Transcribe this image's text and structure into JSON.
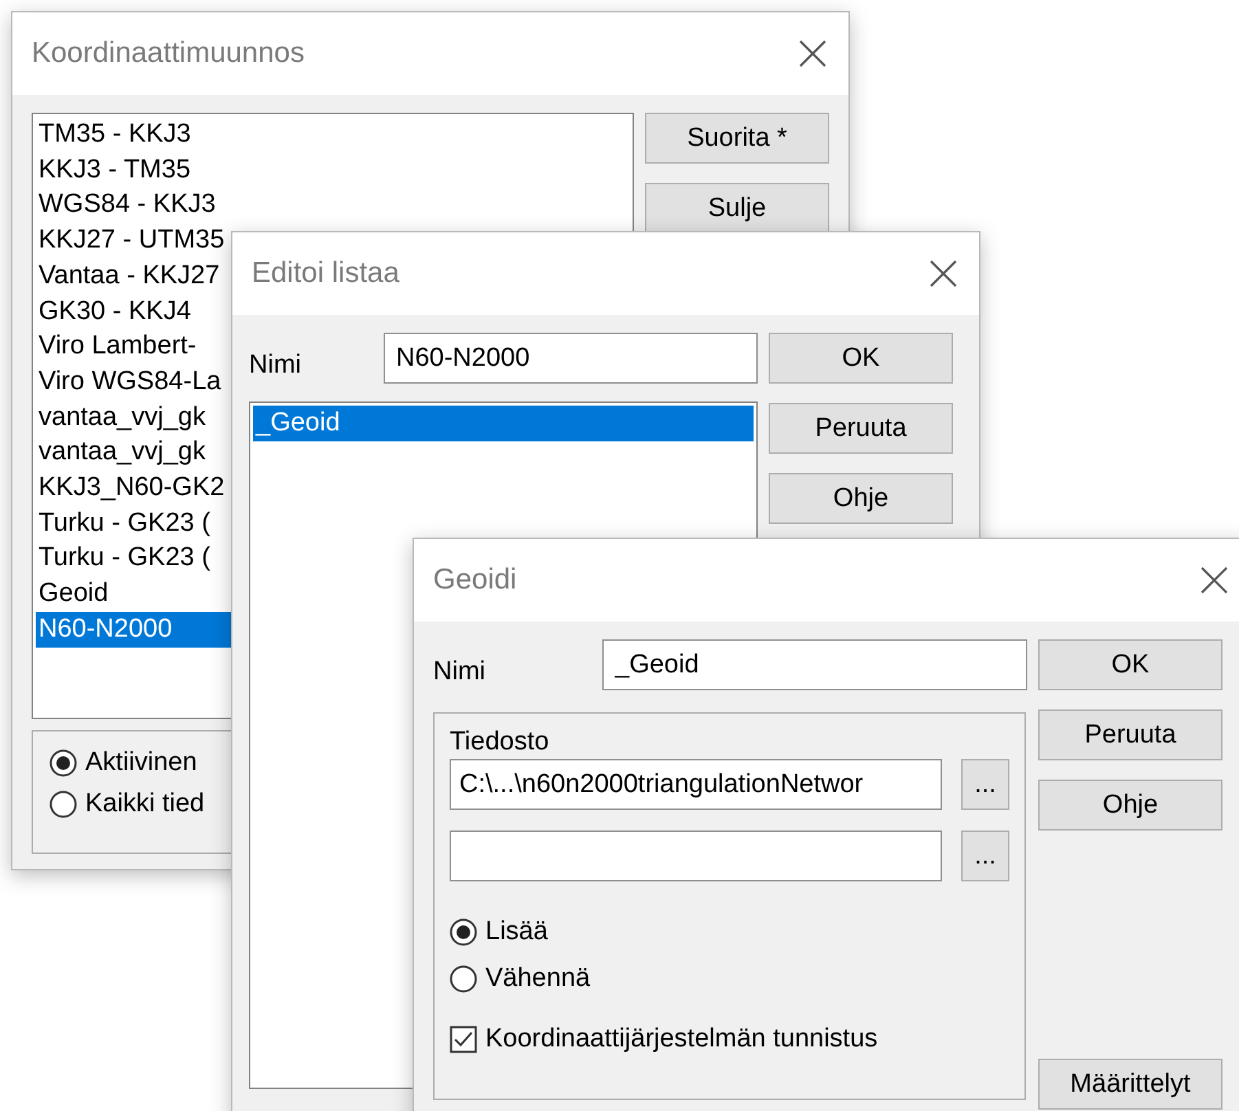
{
  "main_window": {
    "title": "Koordinaattimuunnos",
    "items": [
      {
        "label": "TM35 - KKJ3",
        "selected": false
      },
      {
        "label": "KKJ3 - TM35",
        "selected": false
      },
      {
        "label": "WGS84 - KKJ3",
        "selected": false
      },
      {
        "label": "KKJ27 - UTM35",
        "selected": false
      },
      {
        "label": "Vantaa - KKJ27",
        "selected": false
      },
      {
        "label": "GK30 - KKJ4",
        "selected": false
      },
      {
        "label": "Viro Lambert-",
        "selected": false
      },
      {
        "label": "Viro WGS84-La",
        "selected": false
      },
      {
        "label": "vantaa_vvj_gk",
        "selected": false
      },
      {
        "label": "vantaa_vvj_gk",
        "selected": false
      },
      {
        "label": "KKJ3_N60-GK2",
        "selected": false
      },
      {
        "label": "Turku - GK23 (",
        "selected": false
      },
      {
        "label": "Turku - GK23 (",
        "selected": false
      },
      {
        "label": "Geoid",
        "selected": false
      },
      {
        "label": "N60-N2000",
        "selected": true
      }
    ],
    "buttons": [
      "Suorita *",
      "Sulje"
    ],
    "radios": [
      {
        "label": "Aktiivinen",
        "selected": true
      },
      {
        "label": "Kaikki tied",
        "selected": false
      }
    ]
  },
  "edit_window": {
    "title": "Editoi listaa",
    "name_label": "Nimi",
    "name_value": "N60-N2000",
    "items": [
      {
        "label": "_Geoid",
        "selected": true
      }
    ],
    "buttons": [
      "OK",
      "Peruuta",
      "Ohje"
    ]
  },
  "geoid_window": {
    "title": "Geoidi",
    "name_label": "Nimi",
    "name_value": "_Geoid",
    "file_label": "Tiedosto",
    "files": [
      {
        "value": "C:\\...\\n60n2000triangulationNetwor",
        "browse": "..."
      },
      {
        "browse": "..."
      }
    ],
    "radios": [
      {
        "label": "Lisää",
        "selected": true
      },
      {
        "label": "Vähennä",
        "selected": false
      }
    ],
    "checkbox": {
      "label": "Koordinaattijärjestelmän tunnistus",
      "checked": true
    },
    "buttons": [
      "OK",
      "Peruuta",
      "Ohje"
    ],
    "bottom_button": "Määrittelyt"
  }
}
